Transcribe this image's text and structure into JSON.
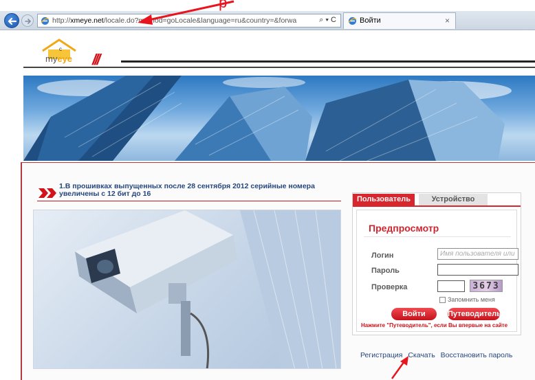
{
  "annotation": {
    "top_caption": "р",
    "arrow_color": "#e8141e"
  },
  "browser": {
    "back_icon": "back-arrow-icon",
    "forward_icon": "forward-arrow-icon",
    "url_prefix": "http://",
    "url_host": "xmeye.net",
    "url_rest": "/locale.do?method=goLocale&language=ru&country=&forward=login",
    "address_controls": "⌕ ▾ C",
    "tab_title": "Войти",
    "tab_close": "×"
  },
  "site": {
    "logo_prefix": "my",
    "logo_eye": "eye",
    "logo_mark": "c",
    "slashes": "///",
    "brand_color": "#d1131b"
  },
  "news": {
    "text": "1.В прошивках выпущенных после 28 сентября 2012 серийные номера увеличены с 12 бит до 16"
  },
  "login": {
    "tab_user": "Пользователь",
    "tab_device": "Устройство",
    "title": "Предпросмотр",
    "login_label": "Логин",
    "login_placeholder": "Имя пользователя или",
    "password_label": "Пароль",
    "captcha_label": "Проверка",
    "captcha_code": "3673",
    "remember_label": "Запомнить меня",
    "login_button": "Войти",
    "guide_button": "Путеводитель",
    "guide_note": "Нажмите \"Путеводитель\", если Вы впервые на сайте"
  },
  "links": {
    "register": "Регистрация",
    "download": "Скачать",
    "restore": "Восстановить пароль"
  }
}
